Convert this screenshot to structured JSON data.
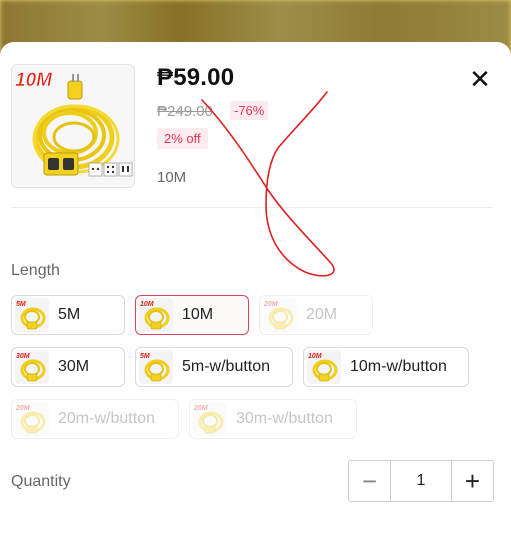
{
  "product": {
    "image_badge": "10M",
    "price": "₱59.00",
    "original_price": "₱249.00",
    "discount_percent": "-76%",
    "coupon_badge": "2% off",
    "selected_variant": "10M",
    "close_symbol": "✕"
  },
  "length": {
    "label": "Length",
    "options": [
      {
        "label": "5M",
        "icon_tag": "5M",
        "state": "normal"
      },
      {
        "label": "10M",
        "icon_tag": "10M",
        "state": "selected"
      },
      {
        "label": "20M",
        "icon_tag": "20M",
        "state": "disabled"
      },
      {
        "label": "30M",
        "icon_tag": "30M",
        "state": "normal"
      },
      {
        "label": "5m-w/button",
        "icon_tag": "5M",
        "state": "normal"
      },
      {
        "label": "10m-w/button",
        "icon_tag": "10M",
        "state": "normal"
      },
      {
        "label": "20m-w/button",
        "icon_tag": "20M",
        "state": "disabled"
      },
      {
        "label": "30m-w/button",
        "icon_tag": "20M",
        "state": "disabled"
      }
    ]
  },
  "quantity": {
    "label": "Quantity",
    "value": "1",
    "minus_symbol": "−",
    "plus_symbol": "+"
  },
  "colors": {
    "accent": "#e8385a",
    "selected_border": "#d8475e",
    "cable_yellow": "#f2d21e",
    "annotation_red": "#e02020"
  },
  "icons": [
    "close-icon",
    "minus-icon",
    "plus-icon",
    "extension-cord-image"
  ]
}
